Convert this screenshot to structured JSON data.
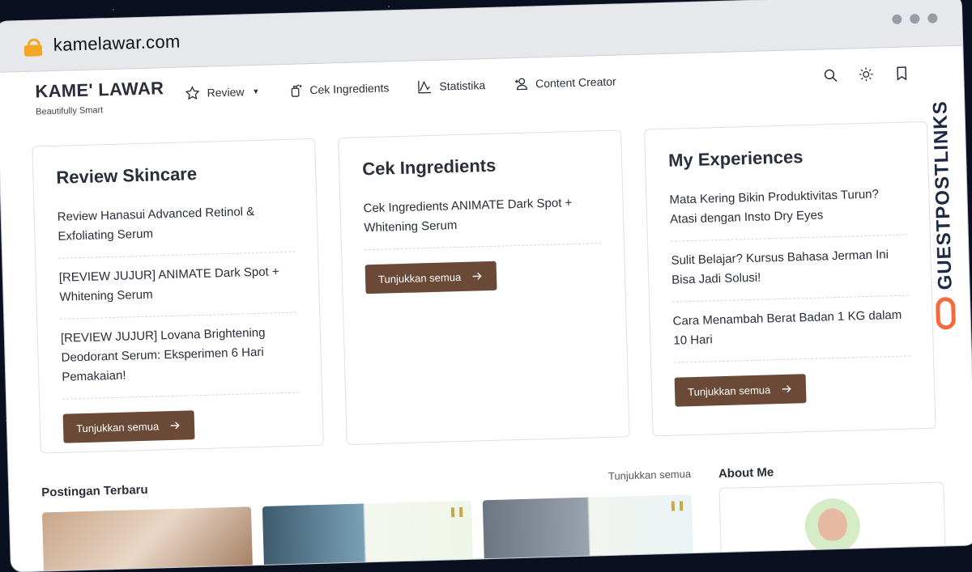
{
  "browser": {
    "url": "kamelawar.com"
  },
  "site": {
    "brand": "KAME' LAWAR",
    "tagline": "Beautifully Smart"
  },
  "nav": {
    "items": [
      {
        "label": "Review",
        "icon": "star-icon"
      },
      {
        "label": "Cek Ingredients",
        "icon": "spray-bottle-icon"
      },
      {
        "label": "Statistika",
        "icon": "chart-icon"
      },
      {
        "label": "Content Creator",
        "icon": "add-user-icon"
      }
    ]
  },
  "cards": [
    {
      "title": "Review Skincare",
      "items": [
        "Review Hanasui Advanced Retinol & Exfoliating Serum",
        "[REVIEW JUJUR] ANIMATE Dark Spot + Whitening Serum",
        "[REVIEW JUJUR] Lovana Brightening Deodorant Serum: Eksperimen 6 Hari Pemakaian!"
      ],
      "button": "Tunjukkan semua"
    },
    {
      "title": "Cek Ingredients",
      "items": [
        "Cek Ingredients ANIMATE Dark Spot + Whitening Serum"
      ],
      "button": "Tunjukkan semua"
    },
    {
      "title": "My Experiences",
      "items": [
        "Mata Kering Bikin Produktivitas Turun? Atasi dengan Insto Dry Eyes",
        "Sulit Belajar? Kursus Bahasa Jerman Ini Bisa Jadi Solusi!",
        "Cara Menambah Berat Badan 1 KG dalam 10 Hari"
      ],
      "button": "Tunjukkan semua"
    }
  ],
  "latest": {
    "title": "Postingan Terbaru",
    "see_all": "Tunjukkan semua"
  },
  "about": {
    "title": "About Me"
  },
  "watermark": "GUESTPOSTLINKS",
  "colors": {
    "button": "#6a4a37",
    "watermark_logo": "#f26a3d",
    "background": "#0b1020"
  }
}
